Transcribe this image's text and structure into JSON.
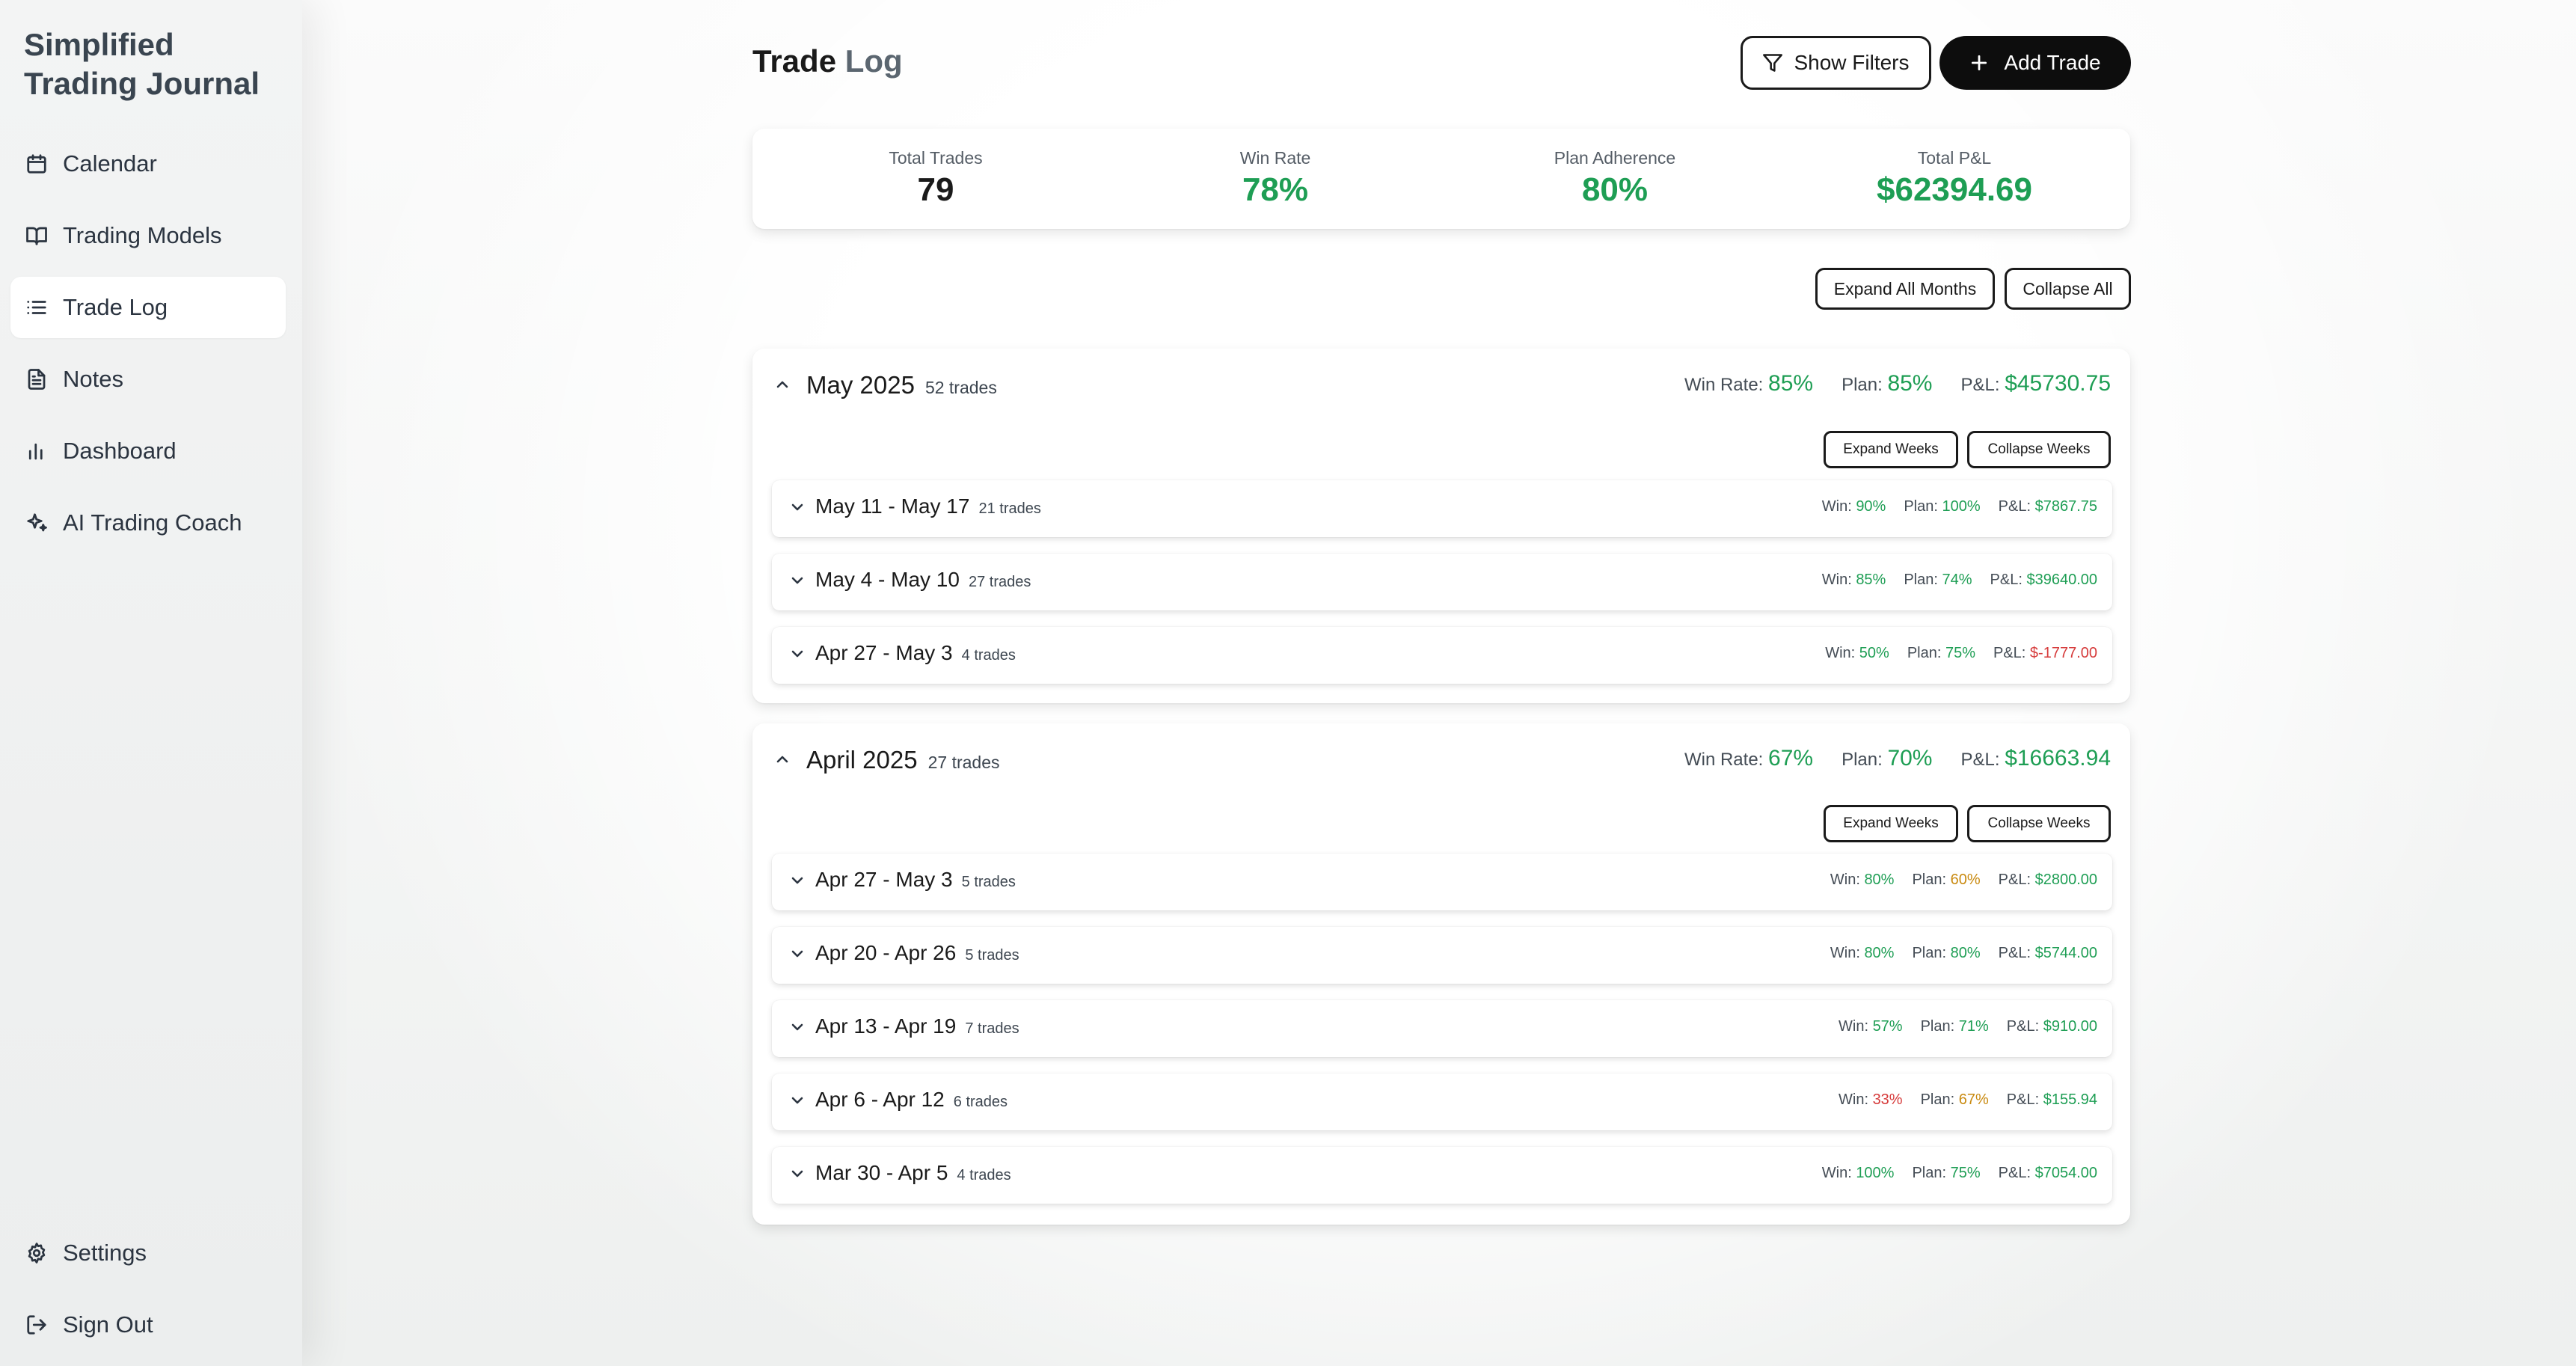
{
  "sidebar": {
    "brand": "Simplified Trading Journal",
    "items": [
      {
        "label": "Calendar",
        "icon": "calendar-icon"
      },
      {
        "label": "Trading Models",
        "icon": "book-icon"
      },
      {
        "label": "Trade Log",
        "icon": "list-icon",
        "active": true
      },
      {
        "label": "Notes",
        "icon": "file-text-icon"
      },
      {
        "label": "Dashboard",
        "icon": "bar-chart-icon"
      },
      {
        "label": "AI Trading Coach",
        "icon": "sparkles-icon"
      }
    ],
    "bottom": [
      {
        "label": "Settings",
        "icon": "gear-icon"
      },
      {
        "label": "Sign Out",
        "icon": "sign-out-icon"
      }
    ]
  },
  "header": {
    "title_main": "Trade",
    "title_muted": "Log",
    "show_filters": "Show Filters",
    "add_trade": "Add Trade"
  },
  "stats": {
    "total_trades": {
      "label": "Total Trades",
      "value": "79"
    },
    "win_rate": {
      "label": "Win Rate",
      "value": "78%"
    },
    "plan_adherence": {
      "label": "Plan Adherence",
      "value": "80%"
    },
    "total_pnl": {
      "label": "Total P&L",
      "value": "$62394.69"
    }
  },
  "controls": {
    "expand_all": "Expand All Months",
    "collapse_all": "Collapse All"
  },
  "labels": {
    "win_rate": "Win Rate:",
    "plan": "Plan:",
    "pnl": "P&L:",
    "win": "Win:",
    "expand_weeks": "Expand Weeks",
    "collapse_weeks": "Collapse Weeks"
  },
  "months": [
    {
      "title": "May 2025",
      "count": "52 trades",
      "win_rate": "85%",
      "plan": "85%",
      "pnl": "$45730.75",
      "weeks": [
        {
          "title": "May 11 - May 17",
          "count": "21 trades",
          "win": "90%",
          "plan": "100%",
          "pnl": "$7867.75",
          "plan_color": "green",
          "win_color": "green",
          "pnl_color": "green"
        },
        {
          "title": "May 4 - May 10",
          "count": "27 trades",
          "win": "85%",
          "plan": "74%",
          "pnl": "$39640.00",
          "plan_color": "green",
          "win_color": "green",
          "pnl_color": "green"
        },
        {
          "title": "Apr 27 - May 3",
          "count": "4 trades",
          "win": "50%",
          "plan": "75%",
          "pnl": "$-1777.00",
          "plan_color": "green",
          "win_color": "green",
          "pnl_color": "red"
        }
      ]
    },
    {
      "title": "April 2025",
      "count": "27 trades",
      "win_rate": "67%",
      "plan": "70%",
      "pnl": "$16663.94",
      "weeks": [
        {
          "title": "Apr 27 - May 3",
          "count": "5 trades",
          "win": "80%",
          "plan": "60%",
          "pnl": "$2800.00",
          "plan_color": "amber",
          "win_color": "green",
          "pnl_color": "green"
        },
        {
          "title": "Apr 20 - Apr 26",
          "count": "5 trades",
          "win": "80%",
          "plan": "80%",
          "pnl": "$5744.00",
          "plan_color": "green",
          "win_color": "green",
          "pnl_color": "green"
        },
        {
          "title": "Apr 13 - Apr 19",
          "count": "7 trades",
          "win": "57%",
          "plan": "71%",
          "pnl": "$910.00",
          "plan_color": "green",
          "win_color": "green",
          "pnl_color": "green"
        },
        {
          "title": "Apr 6 - Apr 12",
          "count": "6 trades",
          "win": "33%",
          "plan": "67%",
          "pnl": "$155.94",
          "plan_color": "amber",
          "win_color": "red",
          "pnl_color": "green"
        },
        {
          "title": "Mar 30 - Apr 5",
          "count": "4 trades",
          "win": "100%",
          "plan": "75%",
          "pnl": "$7054.00",
          "plan_color": "green",
          "win_color": "green",
          "pnl_color": "green"
        }
      ]
    }
  ],
  "colors": {
    "green": "#1e9e54",
    "red": "#d63a3a",
    "amber": "#c98a10",
    "dark": "#0d0d0d"
  }
}
